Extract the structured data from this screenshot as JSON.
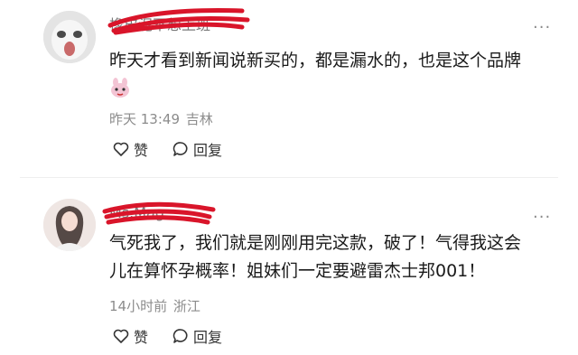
{
  "comments": [
    {
      "username": "橡皮泥不想上班",
      "text": "昨天才看到新闻说新买的，都是漏水的，也是这个品牌",
      "emoji": "rabbit-emoji",
      "time": "昨天 13:49",
      "location": "吉林",
      "like_label": "赞",
      "reply_label": "回复"
    },
    {
      "username": "Ms.Mag",
      "text_line1": "气死我了，我们就是刚刚用完这款，破了！气得我这会",
      "text_line2": "儿在算怀孕概率！姐妹们一定要避雷杰士邦001！",
      "time": "14小时前",
      "location": "浙江",
      "like_label": "赞",
      "reply_label": "回复"
    }
  ],
  "more_label": "···",
  "colors": {
    "scribble": "#d9152a",
    "meta": "#8c8c8c"
  }
}
